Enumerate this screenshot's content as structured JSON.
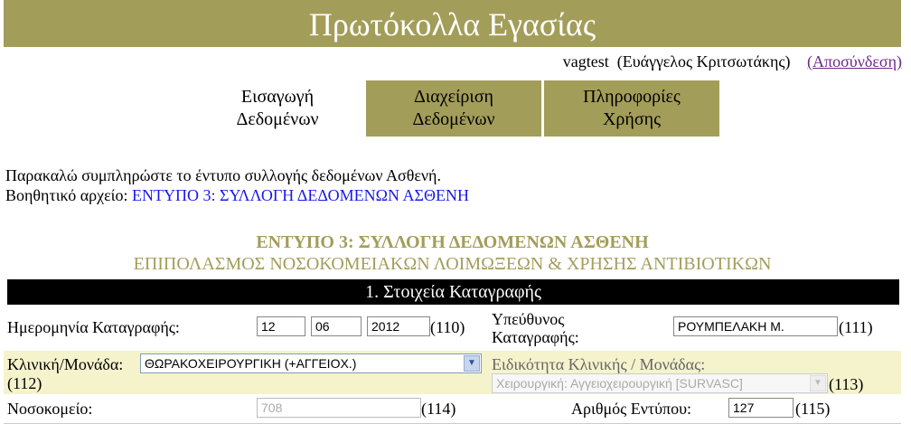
{
  "header": {
    "title": "Πρωτόκολλα Εγασίας"
  },
  "user": {
    "username": "vagtest",
    "fullname": "(Ευάγγελος Κριτσωτάκης)",
    "logout": "(Αποσύνδεση)"
  },
  "tabs": [
    {
      "line1": "Εισαγωγή",
      "line2": "Δεδομένων",
      "active": true
    },
    {
      "line1": "Διαχείριση",
      "line2": "Δεδομένων",
      "active": false
    },
    {
      "line1": "Πληροφορίες",
      "line2": "Χρήσης",
      "active": false
    }
  ],
  "intro": {
    "text": "Παρακαλώ συμπληρώστε το έντυπο συλλογής δεδομένων Ασθενή.",
    "helper_label": "Βοηθητικό αρχείο:",
    "helper_link": "ΕΝΤΥΠΟ 3: ΣΥΛΛΟΓΗ ΔΕΔΟΜΕΝΩΝ ΑΣΘΕΝΗ"
  },
  "form": {
    "title": "ΕΝΤΥΠΟ 3: ΣΥΛΛΟΓΗ ΔΕΔΟΜΕΝΩΝ ΑΣΘΕΝΗ",
    "subtitle": "ΕΠΙΠΟΛΑΣΜΟΣ ΝΟΣΟΚΟΜΕΙΑΚΩΝ ΛΟΙΜΩΞΕΩΝ & ΧΡΗΣΗΣ ΑΝΤΙΒΙΟΤΙΚΩΝ",
    "section": "1. Στοιχεία Καταγραφής",
    "date_label": "Ημερομηνία Καταγραφής:",
    "day": "12",
    "month": "06",
    "year": "2012",
    "date_code": "(110)",
    "resp_label_1": "Υπεύθυνος",
    "resp_label_2": "Καταγραφής:",
    "resp_value": "ΡΟΥΜΠΕΛΑΚΗ Μ.",
    "resp_code": "(111)",
    "clinic_label": "Κλινική/Μονάδα:",
    "clinic_value": "ΘΩΡΑΚΟΧΕΙΡΟΥΡΓΙΚΗ (+ΑΓΓΕΙΟΧ.)",
    "clinic_code": "(112)",
    "spec_label": "Ειδικότητα Κλινικής / Μονάδας:",
    "spec_value": "Χειρουργική: Αγγειοχειρουργική [SURVASC]",
    "spec_code": "(113)",
    "hospital_label": "Νοσοκομείο:",
    "hospital_value": "708",
    "hospital_code": "(114)",
    "formno_label": "Αριθμός Εντύπου:",
    "formno_value": "127",
    "formno_code": "(115)"
  },
  "colors": {
    "accent": "#a39d5a",
    "link": "#1a1ae6",
    "logout": "#6b2a88",
    "band": "#f5f3cc"
  },
  "icons": {
    "dropdown": "chevron-down-icon"
  }
}
